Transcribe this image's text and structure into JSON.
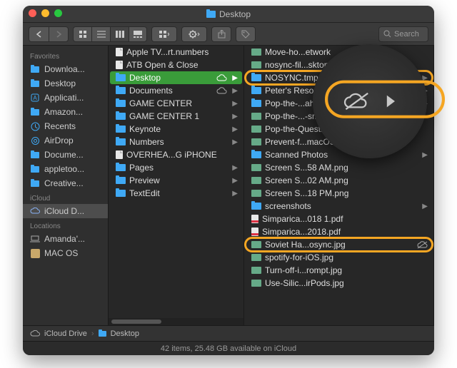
{
  "window": {
    "title": "Desktop"
  },
  "toolbar": {
    "search_placeholder": "Search"
  },
  "sidebar": {
    "sections": [
      {
        "title": "Favorites",
        "items": [
          {
            "label": "Downloa...",
            "icon": "folder"
          },
          {
            "label": "Desktop",
            "icon": "folder"
          },
          {
            "label": "Applicati...",
            "icon": "app"
          },
          {
            "label": "Amazon...",
            "icon": "folder"
          },
          {
            "label": "Recents",
            "icon": "recents"
          },
          {
            "label": "AirDrop",
            "icon": "airdrop"
          },
          {
            "label": "Docume...",
            "icon": "folder"
          },
          {
            "label": "appletoo...",
            "icon": "folder"
          },
          {
            "label": "Creative...",
            "icon": "folder"
          }
        ]
      },
      {
        "title": "iCloud",
        "items": [
          {
            "label": "iCloud D...",
            "icon": "cloud",
            "selected": true
          }
        ]
      },
      {
        "title": "Locations",
        "items": [
          {
            "label": "Amanda'...",
            "icon": "laptop"
          },
          {
            "label": "MAC OS",
            "icon": "disk"
          }
        ]
      }
    ]
  },
  "columns": {
    "col1": [
      {
        "name": "Apple TV...rt.numbers",
        "type": "file"
      },
      {
        "name": "ATB Open & Close",
        "type": "file"
      },
      {
        "name": "Desktop",
        "type": "folder",
        "selected": true,
        "cloud": true,
        "expandable": true
      },
      {
        "name": "Documents",
        "type": "folder",
        "cloud": true,
        "expandable": true
      },
      {
        "name": "GAME CENTER",
        "type": "folder",
        "expandable": true
      },
      {
        "name": "GAME CENTER 1",
        "type": "folder",
        "expandable": true
      },
      {
        "name": "Keynote",
        "type": "folder",
        "expandable": true
      },
      {
        "name": "Numbers",
        "type": "folder",
        "expandable": true
      },
      {
        "name": "OVERHEA...G iPHONE",
        "type": "file"
      },
      {
        "name": "Pages",
        "type": "folder",
        "expandable": true
      },
      {
        "name": "Preview",
        "type": "folder",
        "expandable": true
      },
      {
        "name": "TextEdit",
        "type": "folder",
        "expandable": true
      }
    ],
    "col2": [
      {
        "name": "Move-ho...etwork",
        "type": "img"
      },
      {
        "name": "nosync-fil...sktop.jpg",
        "type": "img"
      },
      {
        "name": "NOSYNC.tmp",
        "type": "folder",
        "expandable": true,
        "highlight": true
      },
      {
        "name": "Peter's Resource",
        "type": "folder",
        "expandable": true
      },
      {
        "name": "Pop-the-...ahjong",
        "type": "folder",
        "expandable": true
      },
      {
        "name": "Pop-the-...-small.jpg",
        "type": "img"
      },
      {
        "name": "Pop-the-Question.jpg",
        "type": "img"
      },
      {
        "name": "Prevent-f...macOS.jpg",
        "type": "img"
      },
      {
        "name": "Scanned Photos",
        "type": "folder",
        "expandable": true
      },
      {
        "name": "Screen S...58 AM.png",
        "type": "img"
      },
      {
        "name": "Screen S...02 AM.png",
        "type": "img"
      },
      {
        "name": "Screen S...18 PM.png",
        "type": "img"
      },
      {
        "name": "screenshots",
        "type": "folder",
        "expandable": true
      },
      {
        "name": "Simparica...018 1.pdf",
        "type": "pdf"
      },
      {
        "name": "Simparica...2018.pdf",
        "type": "pdf"
      },
      {
        "name": "Soviet Ha...osync.jpg",
        "type": "img",
        "nosync": true,
        "highlight": true
      },
      {
        "name": "spotify-for-iOS.jpg",
        "type": "img"
      },
      {
        "name": "Turn-off-i...rompt.jpg",
        "type": "img"
      },
      {
        "name": "Use-Silic...irPods.jpg",
        "type": "img"
      }
    ]
  },
  "pathbar": {
    "seg1": "iCloud Drive",
    "seg2": "Desktop"
  },
  "status": {
    "text": "42 items, 25.48 GB available on iCloud"
  },
  "callout": {
    "icon": "cloud-slash"
  }
}
